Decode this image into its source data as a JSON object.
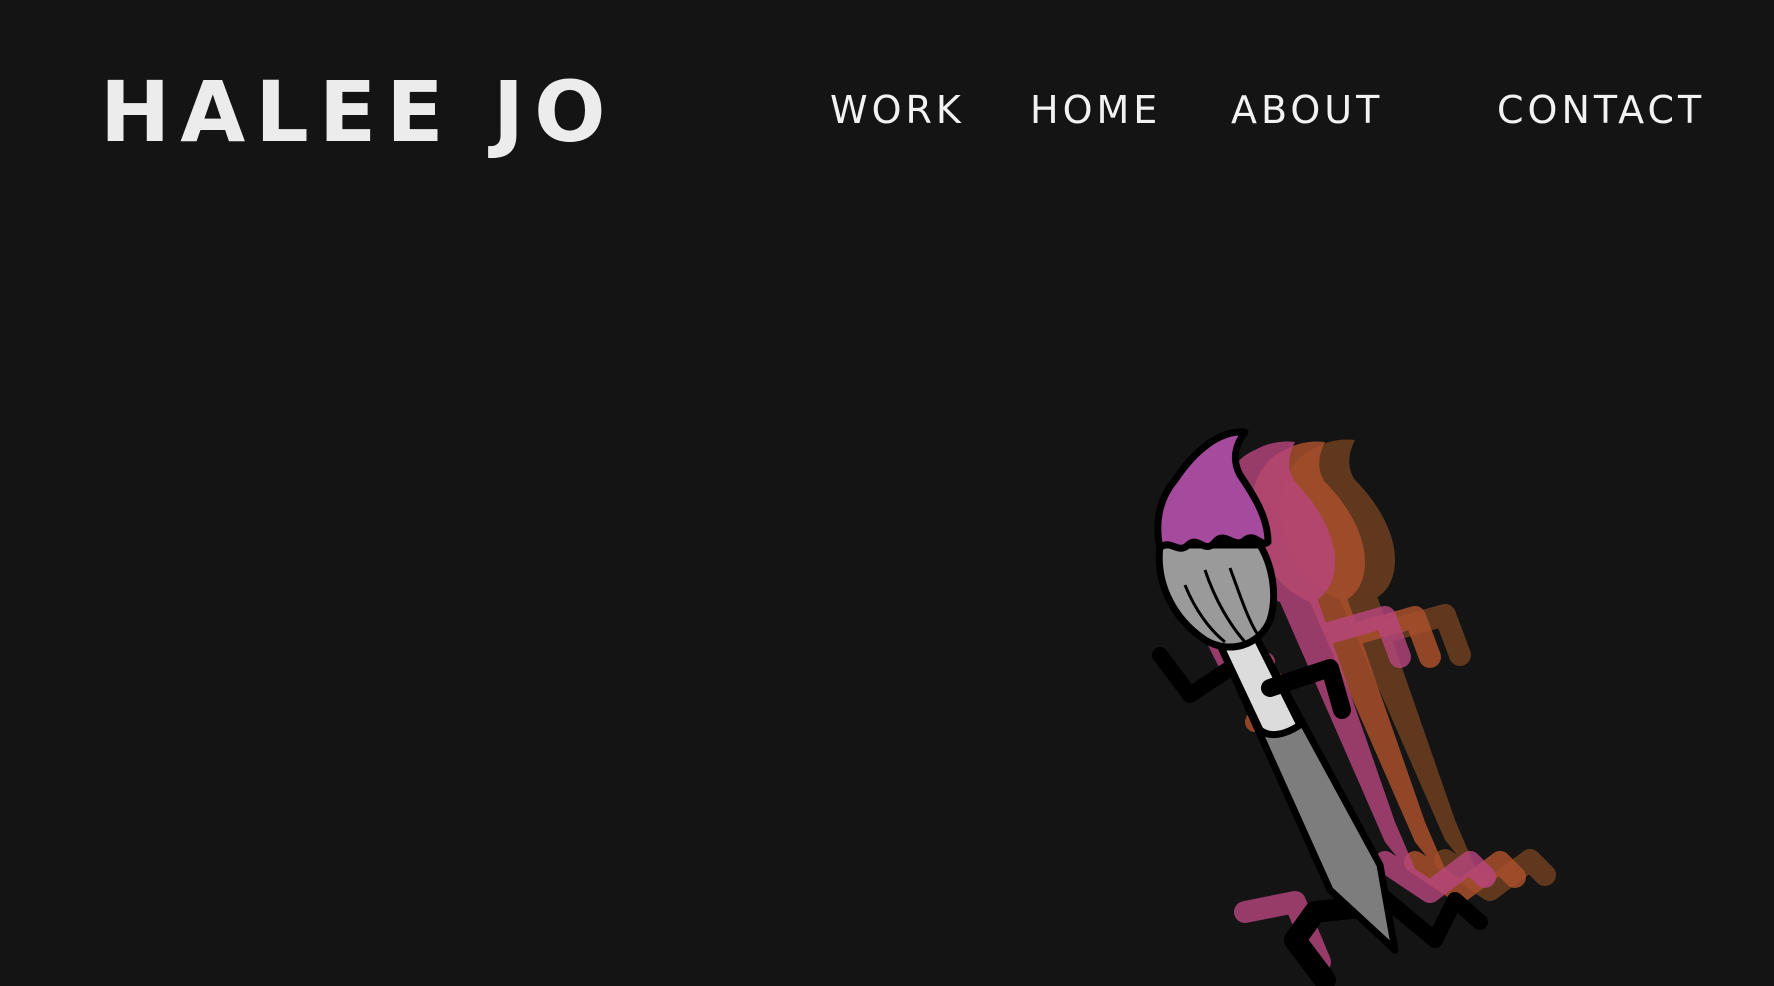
{
  "site": {
    "logo_text": "HALEE JO"
  },
  "nav": {
    "items": [
      {
        "label": "WORK"
      },
      {
        "label": "HOME"
      },
      {
        "label": "ABOUT"
      },
      {
        "label": "CONTACT"
      }
    ]
  },
  "hero": {
    "illustration": "running-paintbrush-character",
    "colors": {
      "background": "#141414",
      "brush_tip": "#a64a9e",
      "ferrule": "#9a9a9a",
      "handle": "#7d7d7d",
      "trail_pink": "#b8467f",
      "trail_orange": "#a84f2c",
      "trail_brown": "#6e3f20"
    }
  }
}
